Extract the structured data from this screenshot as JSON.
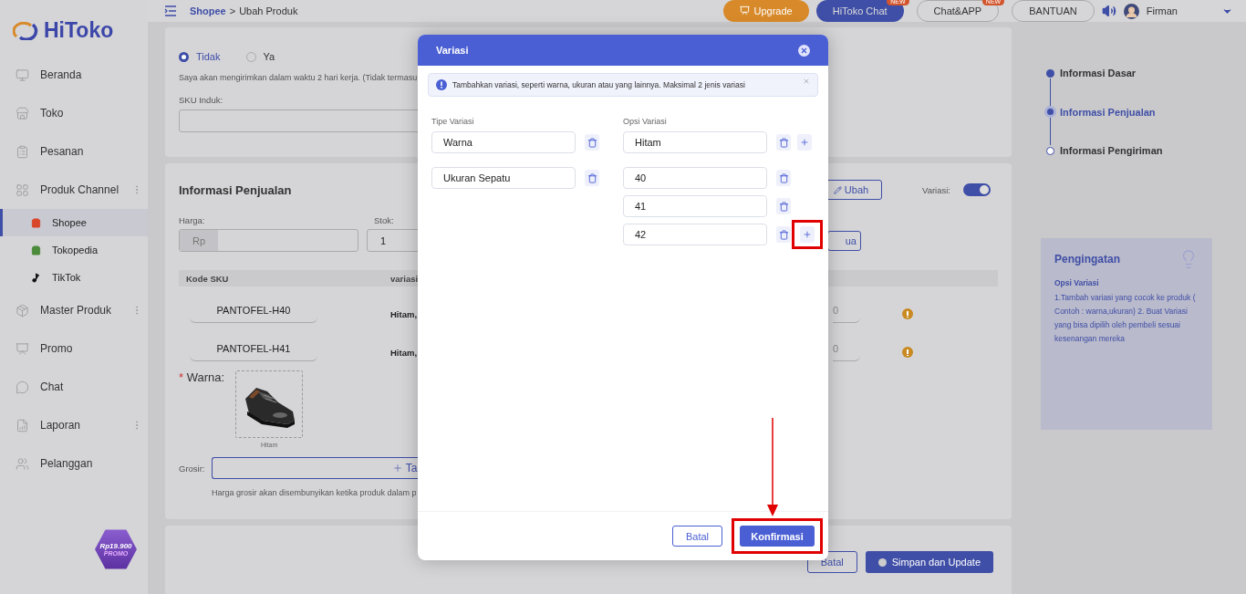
{
  "sidebar": {
    "logo": "HiToko",
    "items": [
      {
        "label": "Beranda",
        "selected": false,
        "menu": false
      },
      {
        "label": "Toko",
        "selected": false,
        "menu": false
      },
      {
        "label": "Pesanan",
        "selected": false,
        "menu": false
      },
      {
        "label": "Produk Channel",
        "selected": false,
        "menu": true,
        "expanded": true,
        "children": [
          {
            "label": "Shopee",
            "selected": true
          },
          {
            "label": "Tokopedia",
            "selected": false
          },
          {
            "label": "TikTok",
            "selected": false
          }
        ]
      },
      {
        "label": "Master Produk",
        "selected": false,
        "menu": true
      },
      {
        "label": "Promo",
        "selected": false,
        "menu": false
      },
      {
        "label": "Chat",
        "selected": false,
        "menu": false
      },
      {
        "label": "Laporan",
        "selected": false,
        "menu": true
      },
      {
        "label": "Pelanggan",
        "selected": false,
        "menu": false
      }
    ],
    "promo_badge": {
      "price": "Rp19.900",
      "label": "PROMO"
    }
  },
  "topbar": {
    "breadcrumb": {
      "link": "Shopee",
      "separator": ">",
      "current": "Ubah Produk"
    },
    "buttons": [
      {
        "label": "Upgrade",
        "kind": "upgrade"
      },
      {
        "label": "HiToko Chat",
        "kind": "primary",
        "badge": "NEW"
      },
      {
        "label": "Chat&APP",
        "kind": "outline",
        "badge": "NEW"
      },
      {
        "label": "BANTUAN",
        "kind": "outline"
      }
    ],
    "user": "Firman"
  },
  "pre_order": {
    "options": [
      {
        "label": "Tidak",
        "selected": true
      },
      {
        "label": "Ya",
        "selected": false
      }
    ],
    "note": "Saya akan mengirimkan dalam waktu 2 hari kerja. (Tidak termasu",
    "sku_label": "SKU Induk:"
  },
  "sales": {
    "title": "Informasi Penjualan",
    "edit_button": "Ubah",
    "variation_toggle": {
      "label": "Variasi:",
      "on": true
    },
    "price_label": "Harga:",
    "price_prefix": "Rp",
    "stock_label": "Stok:",
    "stock_value": "1",
    "bulk_button": "ua",
    "columns": [
      "Kode SKU",
      "variasi"
    ],
    "rows": [
      {
        "sku": "PANTOFEL-H40",
        "variant": "Hitam,",
        "column_3": "0"
      },
      {
        "sku": "PANTOFEL-H41",
        "variant": "Hitam,",
        "column_3": "0"
      }
    ],
    "color_label": "Warna:",
    "required_mark": "*",
    "image_caption": "Hitam",
    "wholesale_label": "Grosir:",
    "wholesale_button": "Ta",
    "wholesale_hint": "Harga grosir akan disembunyikan ketika produk dalam p"
  },
  "footer_buttons": [
    {
      "label": "Batal",
      "kind": "outline"
    },
    {
      "label": "Simpan dan Update",
      "kind": "primary"
    }
  ],
  "steps": [
    {
      "label": "Informasi Dasar",
      "selected": false,
      "done": true
    },
    {
      "label": "Informasi Penjualan",
      "selected": true,
      "done": false
    },
    {
      "label": "Informasi Pengiriman",
      "selected": false,
      "done": false
    }
  ],
  "reminder": {
    "title": "Pengingatan",
    "subtitle": "Opsi Variasi",
    "text": "1.Tambah variasi yang cocok ke produk ( Contoh : warna,ukuran) 2. Buat Variasi yang bisa dipilih oleh pembeli sesuai kesenangan mereka"
  },
  "modal": {
    "title": "Variasi",
    "alert": "Tambahkan variasi, seperti warna, ukuran atau yang lainnya. Maksimal 2 jenis variasi",
    "type_label": "Tipe Variasi",
    "option_label": "Opsi Variasi",
    "types": [
      {
        "name": "Warna",
        "options": [
          {
            "value": "Hitam",
            "add": true,
            "highlighted": false
          }
        ]
      },
      {
        "name": "Ukuran Sepatu",
        "options": [
          {
            "value": "40",
            "add": false,
            "highlighted": false
          },
          {
            "value": "41",
            "add": false,
            "highlighted": false
          },
          {
            "value": "42",
            "add": true,
            "highlighted": true
          }
        ]
      }
    ],
    "buttons": [
      {
        "label": "Batal",
        "kind": "outline",
        "highlighted": false
      },
      {
        "label": "Konfirmasi",
        "kind": "primary",
        "highlighted": true
      }
    ]
  }
}
